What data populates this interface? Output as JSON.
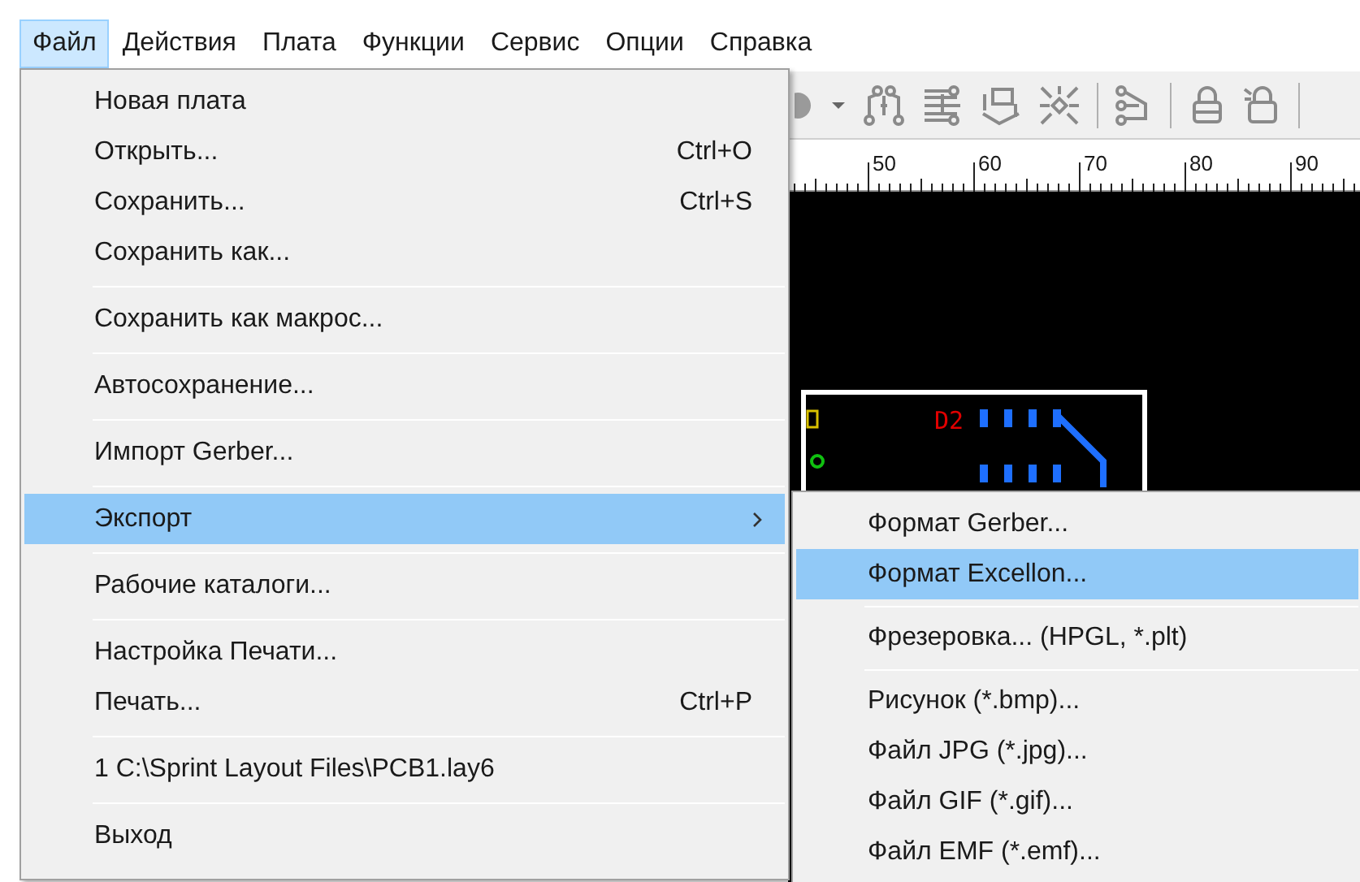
{
  "menubar": [
    {
      "label": "Файл",
      "selected": true
    },
    {
      "label": "Действия",
      "selected": false
    },
    {
      "label": "Плата",
      "selected": false
    },
    {
      "label": "Функции",
      "selected": false
    },
    {
      "label": "Сервис",
      "selected": false
    },
    {
      "label": "Опции",
      "selected": false
    },
    {
      "label": "Справка",
      "selected": false
    }
  ],
  "ruler": {
    "labels": [
      "50",
      "60",
      "70",
      "80",
      "90"
    ]
  },
  "canvas": {
    "part_label": "D2"
  },
  "file_menu": [
    {
      "kind": "item",
      "label": "Новая плата",
      "selected": false
    },
    {
      "kind": "item",
      "label": "Открыть...",
      "shortcut": "Ctrl+O",
      "selected": false
    },
    {
      "kind": "item",
      "label": "Сохранить...",
      "shortcut": "Ctrl+S",
      "selected": false
    },
    {
      "kind": "item",
      "label": "Сохранить как...",
      "selected": false
    },
    {
      "kind": "separator"
    },
    {
      "kind": "item",
      "label": "Сохранить как макрос...",
      "selected": false
    },
    {
      "kind": "separator"
    },
    {
      "kind": "item",
      "label": "Автосохранение...",
      "selected": false
    },
    {
      "kind": "separator"
    },
    {
      "kind": "item",
      "label": "Импорт Gerber...",
      "selected": false
    },
    {
      "kind": "separator"
    },
    {
      "kind": "submenu",
      "label": "Экспорт",
      "selected": true
    },
    {
      "kind": "separator"
    },
    {
      "kind": "item",
      "label": "Рабочие каталоги...",
      "selected": false
    },
    {
      "kind": "separator"
    },
    {
      "kind": "item",
      "label": "Настройка Печати...",
      "selected": false
    },
    {
      "kind": "item",
      "label": "Печать...",
      "shortcut": "Ctrl+P",
      "selected": false
    },
    {
      "kind": "separator"
    },
    {
      "kind": "item",
      "label": "1 C:\\Sprint Layout Files\\PCB1.lay6",
      "selected": false
    },
    {
      "kind": "separator"
    },
    {
      "kind": "item",
      "label": "Выход",
      "selected": false
    }
  ],
  "export_menu": [
    {
      "kind": "item",
      "label": "Формат Gerber...",
      "selected": false
    },
    {
      "kind": "item",
      "label": "Формат Excellon...",
      "selected": true
    },
    {
      "kind": "separator"
    },
    {
      "kind": "item",
      "label": "Фрезеровка... (HPGL, *.plt)",
      "selected": false
    },
    {
      "kind": "separator"
    },
    {
      "kind": "item",
      "label": "Рисунок (*.bmp)...",
      "selected": false
    },
    {
      "kind": "item",
      "label": "Файл JPG (*.jpg)...",
      "selected": false
    },
    {
      "kind": "item",
      "label": "Файл GIF (*.gif)...",
      "selected": false
    },
    {
      "kind": "item",
      "label": "Файл EMF (*.emf)...",
      "selected": false
    }
  ]
}
